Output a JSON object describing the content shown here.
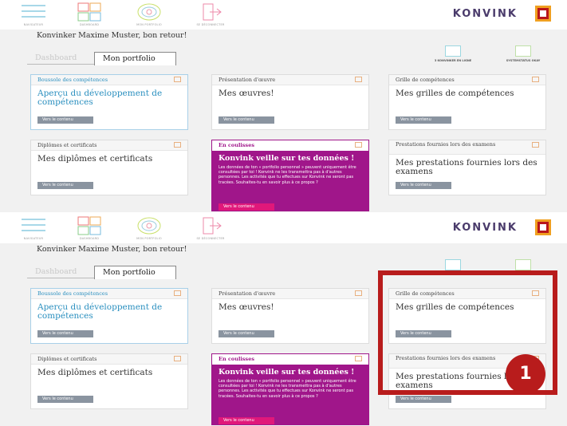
{
  "nav": {
    "items": [
      {
        "label": "NAVIGATEUR",
        "icon": "hamburger-icon"
      },
      {
        "label": "DASHBOARD",
        "icon": "dashboard-icon"
      },
      {
        "label": "MON PORTFOLIO",
        "icon": "portfolio-icon"
      },
      {
        "label": "SE DÉCONNECTER",
        "icon": "logout-icon"
      }
    ],
    "logo_text": "KONVINK",
    "logo_colors": {
      "fill": "#b8161a",
      "border": "#f0a020"
    }
  },
  "welcome": "Konvinker Maxime Muster, bon retour!",
  "tabs": {
    "dashboard": "Dashboard",
    "portfolio": "Mon portfolio"
  },
  "status": {
    "online": "3 KONVINKER EN LIGNE",
    "system": "SYSTEMSTATUS OKAY"
  },
  "cards": [
    {
      "header": "Boussole des compétences",
      "title": "Aperçu du développement de compétences",
      "button": "Vers le contenu",
      "icon": "compass-icon"
    },
    {
      "header": "Présentation d'œuvre",
      "title": "Mes œuvres!",
      "button": "Vers le contenu",
      "icon": "presentation-icon"
    },
    {
      "header": "Grille de compétences",
      "title": "Mes grilles de compétences",
      "button": "Vers le contenu",
      "icon": "grid-icon"
    },
    {
      "header": "Diplômes et certificats",
      "title": "Mes diplômes et certificats",
      "button": "Vers le contenu",
      "icon": "certificate-icon"
    },
    {
      "header": "En coulisses",
      "title": "Konvink veille sur tes données !",
      "text": "Les données de ton « portfolio personnel » peuvent uniquement être consultées par toi ! Konvink ne les transmettra pas à d'autres personnes. Les activités que tu effectues sur Konvink ne seront pas tracées. Souhaites-tu en savoir plus à ce propos ?",
      "button": "Vers le contenu",
      "icon": "backstage-icon"
    },
    {
      "header": "Prestations fournies lors des examens",
      "title": "Mes prestations fournies lors des examens",
      "button": "Vers le contenu",
      "icon": "exam-icon"
    }
  ],
  "callout": {
    "number": "1",
    "color": "#b81c1c"
  }
}
